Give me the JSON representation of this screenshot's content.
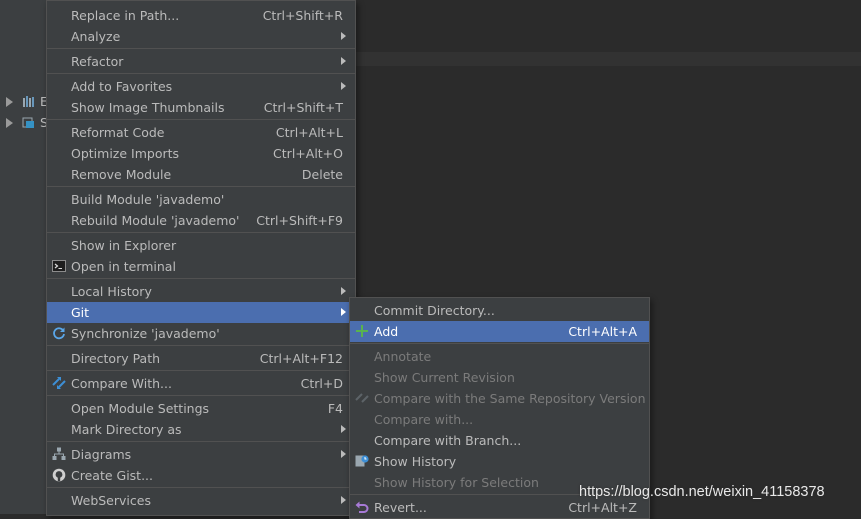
{
  "project_tree": {
    "rows": [
      {
        "label": "E"
      },
      {
        "label": "S"
      }
    ]
  },
  "context_menu": {
    "items": [
      {
        "label": "Replace in Path...",
        "shortcut": "Ctrl+Shift+R"
      },
      {
        "label": "Analyze",
        "submenu": true
      },
      {
        "label": "Refactor",
        "submenu": true
      },
      {
        "label": "Add to Favorites",
        "submenu": true
      },
      {
        "label": "Show Image Thumbnails",
        "shortcut": "Ctrl+Shift+T"
      },
      {
        "label": "Reformat Code",
        "shortcut": "Ctrl+Alt+L"
      },
      {
        "label": "Optimize Imports",
        "shortcut": "Ctrl+Alt+O"
      },
      {
        "label": "Remove Module",
        "shortcut": "Delete"
      },
      {
        "label": "Build Module 'javademo'"
      },
      {
        "label": "Rebuild Module 'javademo'",
        "shortcut": "Ctrl+Shift+F9"
      },
      {
        "label": "Show in Explorer"
      },
      {
        "label": "Open in terminal",
        "icon": "terminal-icon"
      },
      {
        "label": "Local History",
        "submenu": true
      },
      {
        "label": "Git",
        "submenu": true,
        "selected": true
      },
      {
        "label": "Synchronize 'javademo'",
        "icon": "sync-icon"
      },
      {
        "label": "Directory Path",
        "shortcut": "Ctrl+Alt+F12"
      },
      {
        "label": "Compare With...",
        "shortcut": "Ctrl+D",
        "icon": "compare-icon"
      },
      {
        "label": "Open Module Settings",
        "shortcut": "F4"
      },
      {
        "label": "Mark Directory as",
        "submenu": true
      },
      {
        "label": "Diagrams",
        "submenu": true,
        "icon": "diagram-icon"
      },
      {
        "label": "Create Gist...",
        "icon": "github-icon"
      },
      {
        "label": "WebServices",
        "submenu": true
      }
    ]
  },
  "git_submenu": {
    "items": [
      {
        "label": "Commit Directory..."
      },
      {
        "label": "Add",
        "shortcut": "Ctrl+Alt+A",
        "selected": true,
        "icon": "plus-icon"
      },
      {
        "label": "Annotate",
        "disabled": true
      },
      {
        "label": "Show Current Revision",
        "disabled": true
      },
      {
        "label": "Compare with the Same Repository Version",
        "disabled": true,
        "icon": "compare-icon"
      },
      {
        "label": "Compare with...",
        "disabled": true
      },
      {
        "label": "Compare with Branch..."
      },
      {
        "label": "Show History",
        "icon": "history-icon"
      },
      {
        "label": "Show History for Selection",
        "disabled": true
      },
      {
        "label": "Revert...",
        "shortcut": "Ctrl+Alt+Z",
        "icon": "revert-icon"
      }
    ]
  },
  "watermark": "https://blog.csdn.net/weixin_41158378",
  "colors": {
    "menu_bg": "#3c3f41",
    "selection": "#4b6eaf",
    "text": "#bbbbbb",
    "disabled_text": "#7b7b7b",
    "editor_bg": "#2b2b2b"
  }
}
